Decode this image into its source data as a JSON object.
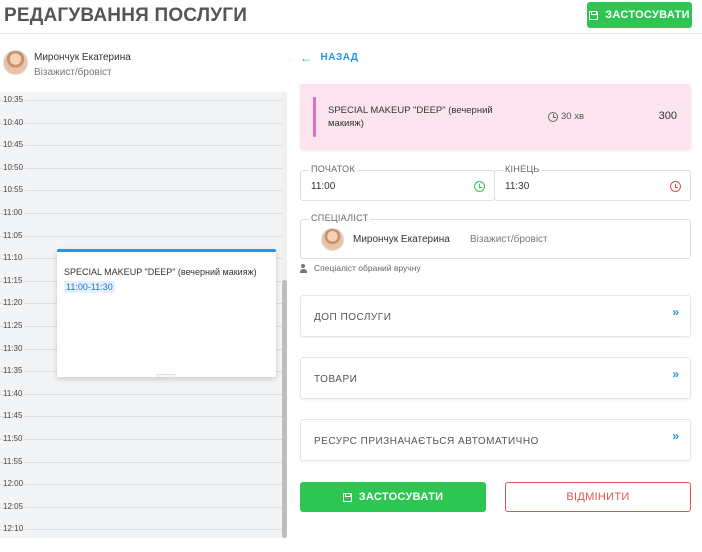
{
  "header": {
    "title": "РЕДАГУВАННЯ ПОСЛУГИ",
    "apply_label": "ЗАСТОСУВАТИ"
  },
  "sidebar": {
    "specialist_name": "Мирончук Екатерина",
    "specialist_role": "Візажист/бровіст",
    "times": [
      "10:35",
      "10:40",
      "10:45",
      "10:50",
      "10:55",
      "11:00",
      "11:05",
      "11:10",
      "11:15",
      "11:20",
      "11:25",
      "11:30",
      "11:35",
      "11:40",
      "11:45",
      "11:50",
      "11:55",
      "12:00",
      "12:05",
      "12:10"
    ],
    "event": {
      "title": "SPECIAL MAKEUP \"DEEP\" (вечерний макияж)",
      "time": "11:00-11:30"
    }
  },
  "main": {
    "back_label": "НАЗАД",
    "service": {
      "name": "SPECIAL MAKEUP \"DEEP\" (вечерний макияж)",
      "duration": "30 хв",
      "price": "300"
    },
    "start": {
      "label": "ПОЧАТОК",
      "value": "11:00"
    },
    "end": {
      "label": "КІНЕЦЬ",
      "value": "11:30"
    },
    "specialist": {
      "label": "СПЕЦІАЛІСТ",
      "name": "Мирончук Екатерина",
      "role": "Візажист/бровіст"
    },
    "manual_note": "Спеціаліст обраний вручну",
    "sections": [
      "ДОП ПОСЛУГИ",
      "ТОВАРИ",
      "РЕСУРС ПРИЗНАЧАЄТЬСЯ АВТОМАТИЧНО"
    ],
    "apply_label": "ЗАСТОСУВАТИ",
    "cancel_label": "ВІДМІНИТИ"
  },
  "colors": {
    "primary_green": "#2dc653",
    "accent_blue": "#2196f3",
    "danger_red": "#e55353",
    "service_card_bg": "#fce4ef"
  }
}
